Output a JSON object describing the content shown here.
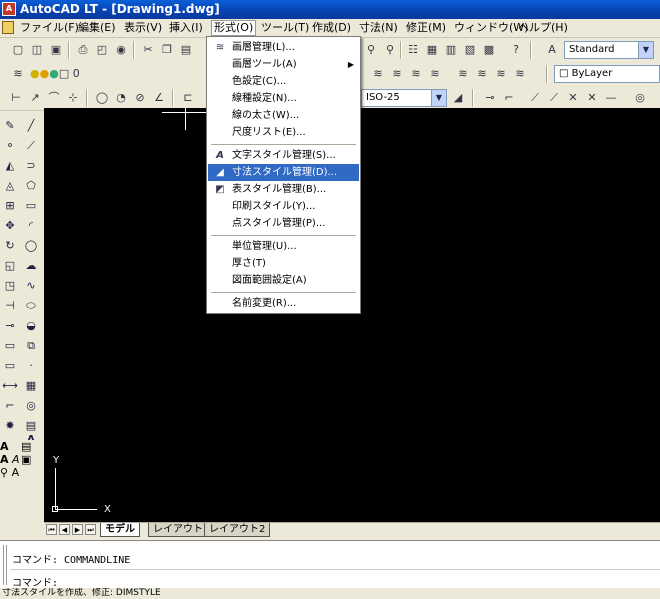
{
  "window": {
    "title": "AutoCAD LT - [Drawing1.dwg]"
  },
  "menubar": {
    "items": [
      "ファイル(F)",
      "編集(E)",
      "表示(V)",
      "挿入(I)",
      "形式(O)",
      "ツール(T)",
      "作成(D)",
      "寸法(N)",
      "修正(M)",
      "ウィンドウ(W)",
      "ヘルプ(H)"
    ]
  },
  "format_menu": {
    "items": [
      {
        "label": "画層管理(L)..."
      },
      {
        "label": "画層ツール(A)"
      },
      {
        "label": "色設定(C)..."
      },
      {
        "label": "線種設定(N)..."
      },
      {
        "label": "線の太さ(W)..."
      },
      {
        "label": "尺度リスト(E)..."
      },
      {
        "label": "文字スタイル管理(S)..."
      },
      {
        "label": "寸法スタイル管理(D)..."
      },
      {
        "label": "表スタイル管理(B)..."
      },
      {
        "label": "印刷スタイル(Y)..."
      },
      {
        "label": "点スタイル管理(P)..."
      },
      {
        "label": "単位管理(U)..."
      },
      {
        "label": "厚さ(T)"
      },
      {
        "label": "図面範囲設定(A)"
      },
      {
        "label": "名前変更(R)..."
      }
    ]
  },
  "toolbar": {
    "text_style_value": "Standard",
    "layer_value": "0",
    "color_value": "ByLayer",
    "dim_style_value": "ISO-25"
  },
  "ucs": {
    "y_label": "Y",
    "x_label": "X"
  },
  "layout_tabs": [
    "モデル",
    "レイアウト1",
    "レイアウト2"
  ],
  "command": {
    "history": "コマンド: COMMANDLINE",
    "prompt": "コマンド:"
  },
  "status": {
    "text": "寸法スタイルを作成、修正: DIMSTYLE"
  },
  "colors": {
    "title_bar": "#0a5fd8",
    "highlight": "#316ac5",
    "canvas": "#000000"
  }
}
